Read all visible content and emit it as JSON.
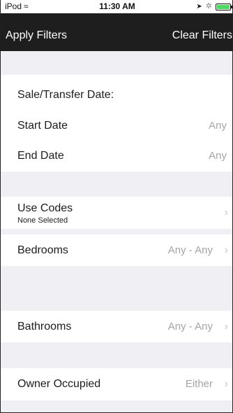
{
  "status_bar": {
    "device": "iPod",
    "time": "11:30 AM",
    "wifi_icon": "wifi-icon",
    "location_icon": "location-arrow-icon",
    "bluetooth_icon": "bluetooth-icon",
    "battery_icon": "battery-charging-icon"
  },
  "nav": {
    "left_button": "Apply Filters",
    "right_button": "Clear Filters"
  },
  "sale_section": {
    "header": "Sale/Transfer Date:",
    "start_label": "Start Date",
    "start_value": "Any",
    "end_label": "End Date",
    "end_value": "Any"
  },
  "use_codes": {
    "label": "Use Codes",
    "sub": "None Selected"
  },
  "bedrooms": {
    "label": "Bedrooms",
    "value": "Any - Any"
  },
  "bathrooms": {
    "label": "Bathrooms",
    "value": "Any - Any"
  },
  "owner_occupied": {
    "label": "Owner Occupied",
    "value": "Either"
  },
  "colors": {
    "nav_background": "#1e1e1e",
    "group_background": "#efeff4",
    "value_text": "#a4a4a8",
    "battery": "#4cd964"
  }
}
